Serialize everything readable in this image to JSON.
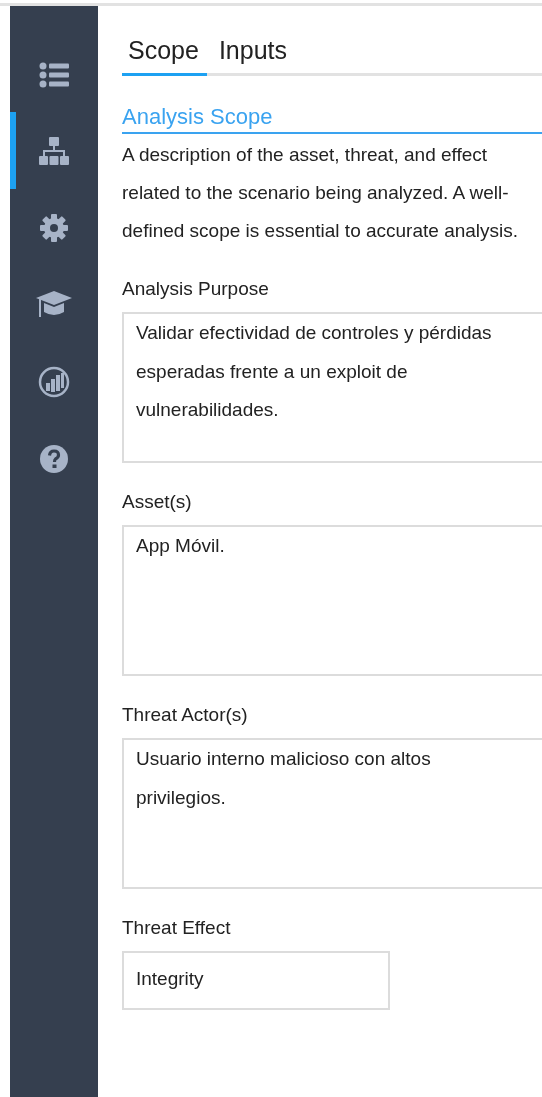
{
  "sidebar": {
    "items": [
      {
        "selected": false
      },
      {
        "selected": true
      },
      {
        "selected": false
      },
      {
        "selected": false
      },
      {
        "selected": false
      },
      {
        "selected": false
      }
    ]
  },
  "tabs": [
    {
      "label": "Scope",
      "selected": true
    },
    {
      "label": "Inputs",
      "selected": false
    }
  ],
  "section": {
    "title": "Analysis Scope",
    "description": "A description of the asset, threat, and effect related to the scenario being analyzed. A well-defined scope is essential to accurate analysis."
  },
  "fields": [
    {
      "kind": "multiline",
      "label": "Analysis Purpose",
      "value": "Validar efectividad de controles y pérdidas esperadas frente a un exploit de vulnerabilidades."
    },
    {
      "kind": "multiline",
      "label": "Asset(s)",
      "value": "App Móvil."
    },
    {
      "kind": "multiline",
      "label": "Threat Actor(s)",
      "value": "Usuario interno malicioso con altos privilegios."
    },
    {
      "kind": "single",
      "label": "Threat Effect",
      "value": "Integrity"
    }
  ]
}
